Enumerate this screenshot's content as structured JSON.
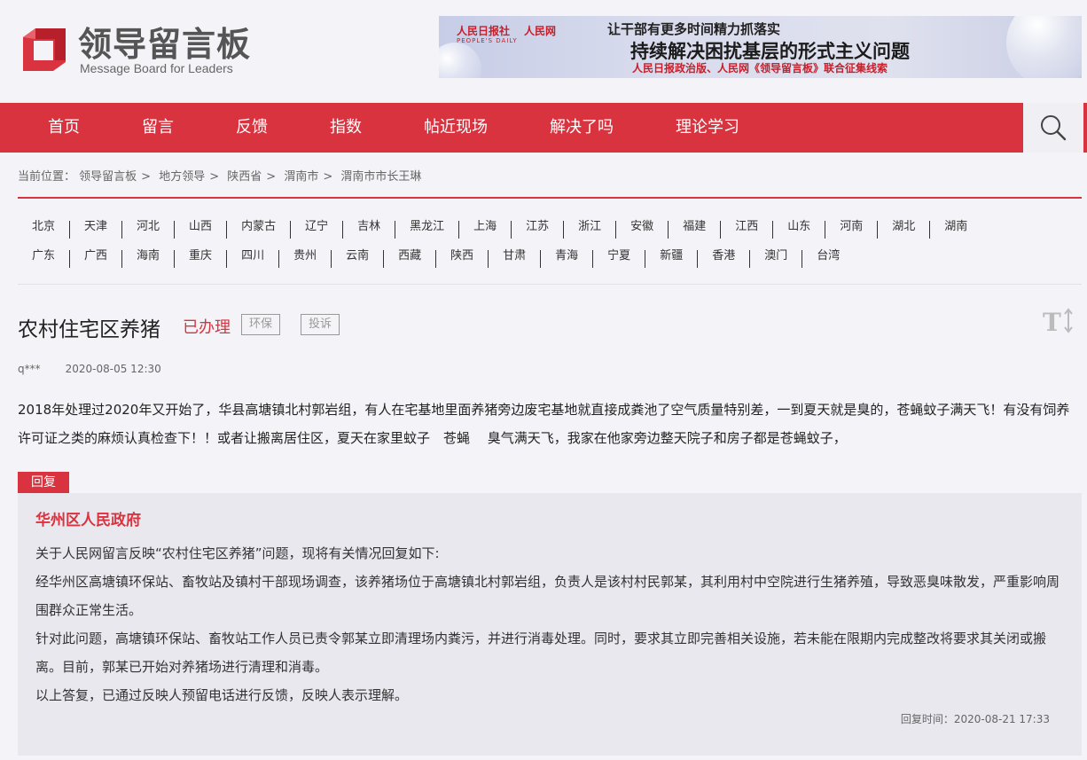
{
  "header": {
    "logo_cn": "领导留言板",
    "logo_en": "Message Board for Leaders",
    "banner": {
      "brand1": "人民日报社",
      "brand1_sub": "PEOPLE'S DAILY",
      "brand2": "人民网",
      "line1": "让干部有更多时间精力抓落实",
      "line2": "持续解决困扰基层的形式主义问题",
      "line3": "人民日报政治版、人民网《领导留言板》联合征集线索"
    }
  },
  "nav": {
    "items": [
      "首页",
      "留言",
      "反馈",
      "指数",
      "帖近现场",
      "解决了吗",
      "理论学习"
    ]
  },
  "breadcrumb": {
    "prefix": "当前位置：",
    "items": [
      "领导留言板",
      "地方领导",
      "陕西省",
      "渭南市",
      "渭南市市长王琳"
    ],
    "separator": ">"
  },
  "provinces": {
    "row1": [
      "北京",
      "天津",
      "河北",
      "山西",
      "内蒙古",
      "辽宁",
      "吉林",
      "黑龙江",
      "上海",
      "江苏",
      "浙江",
      "安徽",
      "福建",
      "江西",
      "山东",
      "河南",
      "湖北",
      "湖南"
    ],
    "row2": [
      "广东",
      "广西",
      "海南",
      "重庆",
      "四川",
      "贵州",
      "云南",
      "西藏",
      "陕西",
      "甘肃",
      "青海",
      "宁夏",
      "新疆",
      "香港",
      "澳门",
      "台湾"
    ]
  },
  "post": {
    "title": "农村住宅区养猪",
    "status": "已办理",
    "tags": [
      "环保",
      "投诉"
    ],
    "author": "q***",
    "date": "2020-08-05 12:30",
    "content": "2018年处理过2020年又开始了，华县高塘镇北村郭岩组，有人在宅基地里面养猪旁边废宅基地就直接成粪池了空气质量特别差，一到夏天就是臭的，苍蝇蚊子满天飞！有没有饲养许可证之类的麻烦认真检查下！！或者让搬离居住区，夏天在家里蚊子　苍蝇　 臭气满天飞，我家在他家旁边整天院子和房子都是苍蝇蚊子，"
  },
  "reply": {
    "tab_label": "回复",
    "org": "华州区人民政府",
    "paragraphs": [
      "关于人民网留言反映“农村住宅区养猪”问题，现将有关情况回复如下:",
      "经华州区高塘镇环保站、畜牧站及镇村干部现场调查，该养猪场位于高塘镇北村郭岩组，负责人是该村村民郭某，其利用村中空院进行生猪养殖，导致恶臭味散发，严重影响周围群众正常生活。",
      "针对此问题，高塘镇环保站、畜牧站工作人员已责令郭某立即清理场内粪污，并进行消毒处理。同时，要求其立即完善相关设施，若未能在限期内完成整改将要求其关闭或搬离。目前，郭某已开始对养猪场进行清理和消毒。",
      "以上答复，已通过反映人预留电话进行反馈，反映人表示理解。"
    ],
    "time_label": "回复时间：",
    "time": "2020-08-21 17:33"
  },
  "icons": {
    "search": "search-icon",
    "font_size": "font-size-icon"
  },
  "colors": {
    "brand_red": "#d8333f",
    "background": "#f4f3f7",
    "reply_bg": "#e9e8ee"
  }
}
